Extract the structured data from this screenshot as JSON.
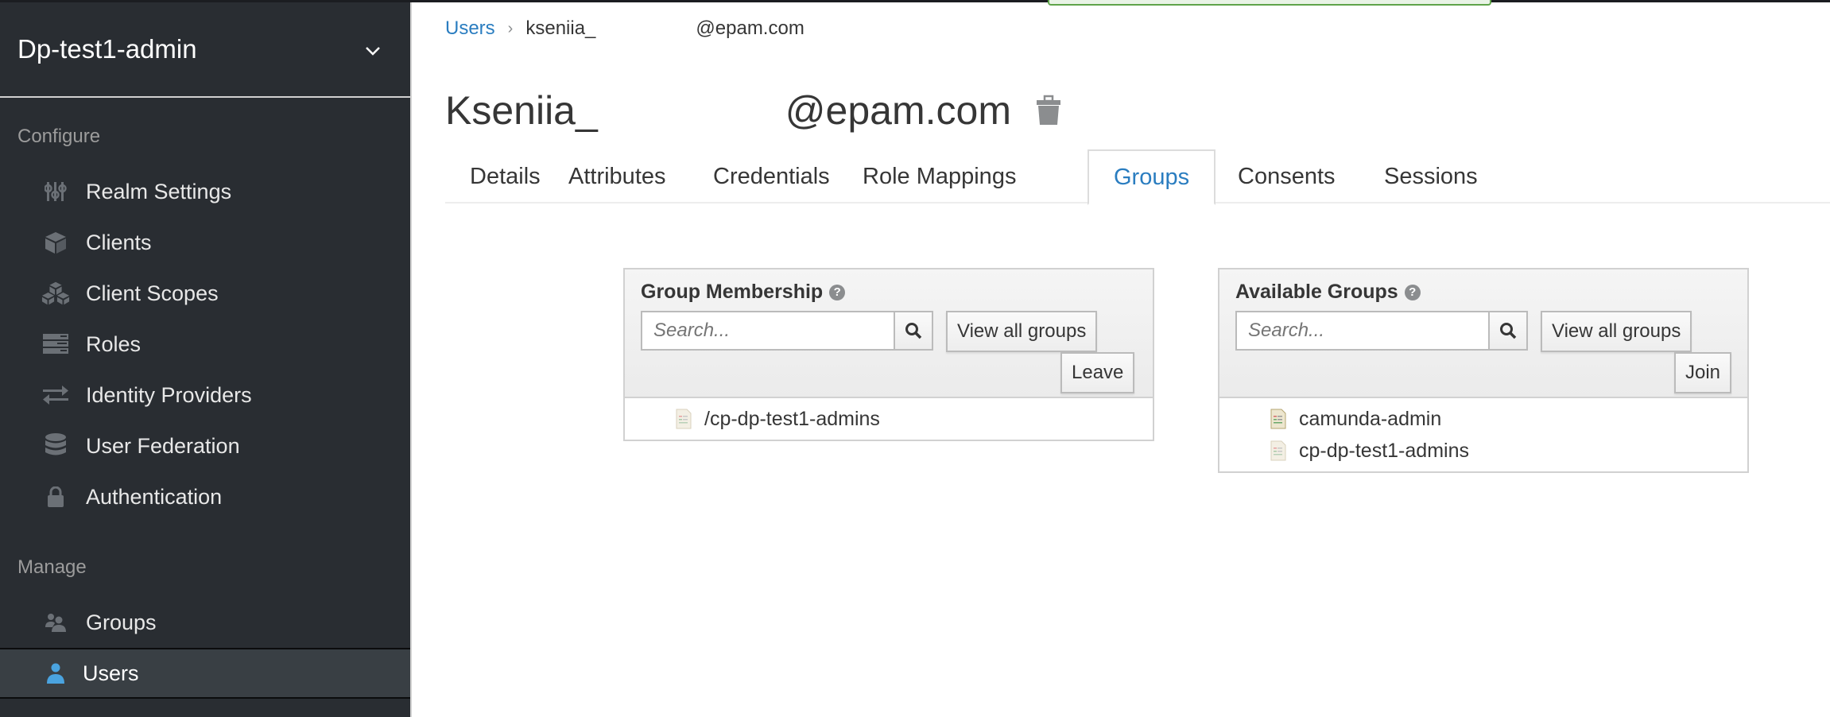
{
  "sidebar": {
    "realm": "Dp-test1-admin",
    "configure_label": "Configure",
    "configure_items": [
      {
        "label": "Realm Settings",
        "icon": "sliders-icon"
      },
      {
        "label": "Clients",
        "icon": "cube-icon"
      },
      {
        "label": "Client Scopes",
        "icon": "cubes-icon"
      },
      {
        "label": "Roles",
        "icon": "server-icon"
      },
      {
        "label": "Identity Providers",
        "icon": "exchange-icon"
      },
      {
        "label": "User Federation",
        "icon": "database-icon"
      },
      {
        "label": "Authentication",
        "icon": "lock-icon"
      }
    ],
    "manage_label": "Manage",
    "manage_items": [
      {
        "label": "Groups",
        "icon": "users-icon"
      },
      {
        "label": "Users",
        "icon": "user-icon",
        "active": true
      }
    ]
  },
  "breadcrumb": {
    "root": "Users",
    "current_part1": "kseniia_",
    "current_part2": "@epam.com"
  },
  "title": {
    "part1": "Kseniia_",
    "part2": "@epam.com"
  },
  "tabs": [
    {
      "label": "Details"
    },
    {
      "label": "Attributes"
    },
    {
      "label": "Credentials"
    },
    {
      "label": "Role Mappings"
    },
    {
      "label": "Groups",
      "active": true
    },
    {
      "label": "Consents"
    },
    {
      "label": "Sessions"
    }
  ],
  "membership": {
    "title": "Group Membership",
    "search_placeholder": "Search...",
    "view_all": "View all groups",
    "action": "Leave",
    "items": [
      "/cp-dp-test1-admins"
    ]
  },
  "available": {
    "title": "Available Groups",
    "search_placeholder": "Search...",
    "view_all": "View all groups",
    "action": "Join",
    "items": [
      "camunda-admin",
      "cp-dp-test1-admins"
    ]
  },
  "colors": {
    "accent": "#2a7dc0",
    "sidebar_bg": "#292d32",
    "active_user_icon": "#4aa3df"
  }
}
